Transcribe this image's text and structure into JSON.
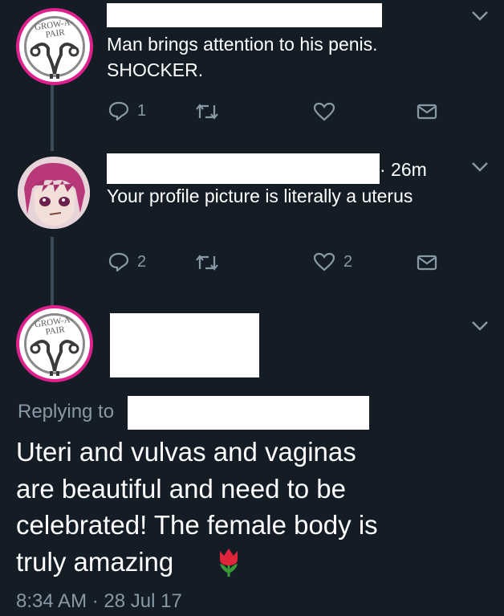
{
  "tweet1": {
    "avatar_logo_text": "GROW-A-PAIR",
    "text_line1": "Man brings attention to his penis.",
    "text_line2": "SHOCKER.",
    "reply_count": "1",
    "like_count": ""
  },
  "tweet2": {
    "time": "· 26m",
    "text": "Your profile picture is literally a uterus",
    "reply_count": "2",
    "like_count": "2"
  },
  "main_tweet": {
    "avatar_logo_text": "GROW-A-PAIR",
    "replying_to_label": "Replying to",
    "text_line1": "Uteri and vulvas and vaginas",
    "text_line2": "are beautiful and need to be",
    "text_line3": "celebrated! The female body is",
    "text_line4": "truly amazing",
    "emoji": "🌷",
    "timestamp": "8:34 AM · 28 Jul 17"
  },
  "icons": [
    "reply-icon",
    "retweet-icon",
    "like-icon",
    "dm-icon",
    "chevron-down-icon",
    "tulip-icon"
  ],
  "colors": {
    "background": "#141d26",
    "text": "#ffffff",
    "muted": "#8899a6",
    "logo_border": "#e0208c"
  }
}
